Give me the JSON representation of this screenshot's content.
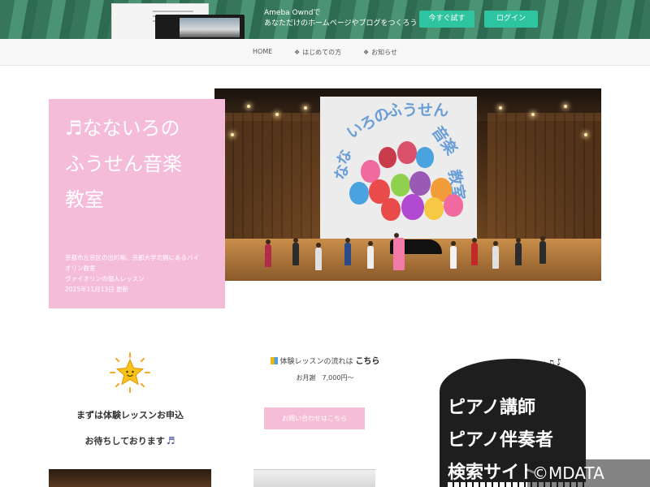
{
  "promo": {
    "line1": "Ameba Owndで",
    "line2": "あなただけのホームページやブログをつくろう",
    "try_label": "今すぐ試す",
    "login_label": "ログイン"
  },
  "nav": {
    "items": [
      {
        "label": "HOME"
      },
      {
        "label": "はじめての方"
      },
      {
        "label": "お知らせ"
      }
    ]
  },
  "hero": {
    "title_line1": "♬なないろの",
    "title_line2": "ふうせん音楽",
    "title_line3": "教室",
    "desc_line1": "京都市左京区の出町柳、京都大学北側にあるバイ",
    "desc_line2": "オリン教室",
    "desc_line3": "ヴァイオリンの個人レッスン",
    "desc_line4": "2025年11月13日 更新",
    "sign_text": "なないろのふうせん音楽教室"
  },
  "lesson": {
    "line1": "まずは体験レッスンお申込",
    "line2": "お待ちしております",
    "note": "♬"
  },
  "trial": {
    "prefix": "体験レッスンの流れは",
    "link": "こちら",
    "fee": "お月謝　7,000円〜",
    "contact_button": "お問い合わせはこちら"
  },
  "piano_banner": {
    "line1": "ピアノ講師",
    "line2": "ピアノ伴奏者",
    "line3": "検索サイト",
    "notes": "♪♫♪♩♫♪"
  },
  "watermark": "©MDATA",
  "colors": {
    "promo_green": "#2ec4a0",
    "hero_pink": "#f5bcd9",
    "button_pink": "#f6bdd6",
    "piano_black": "#1e1e1e"
  }
}
